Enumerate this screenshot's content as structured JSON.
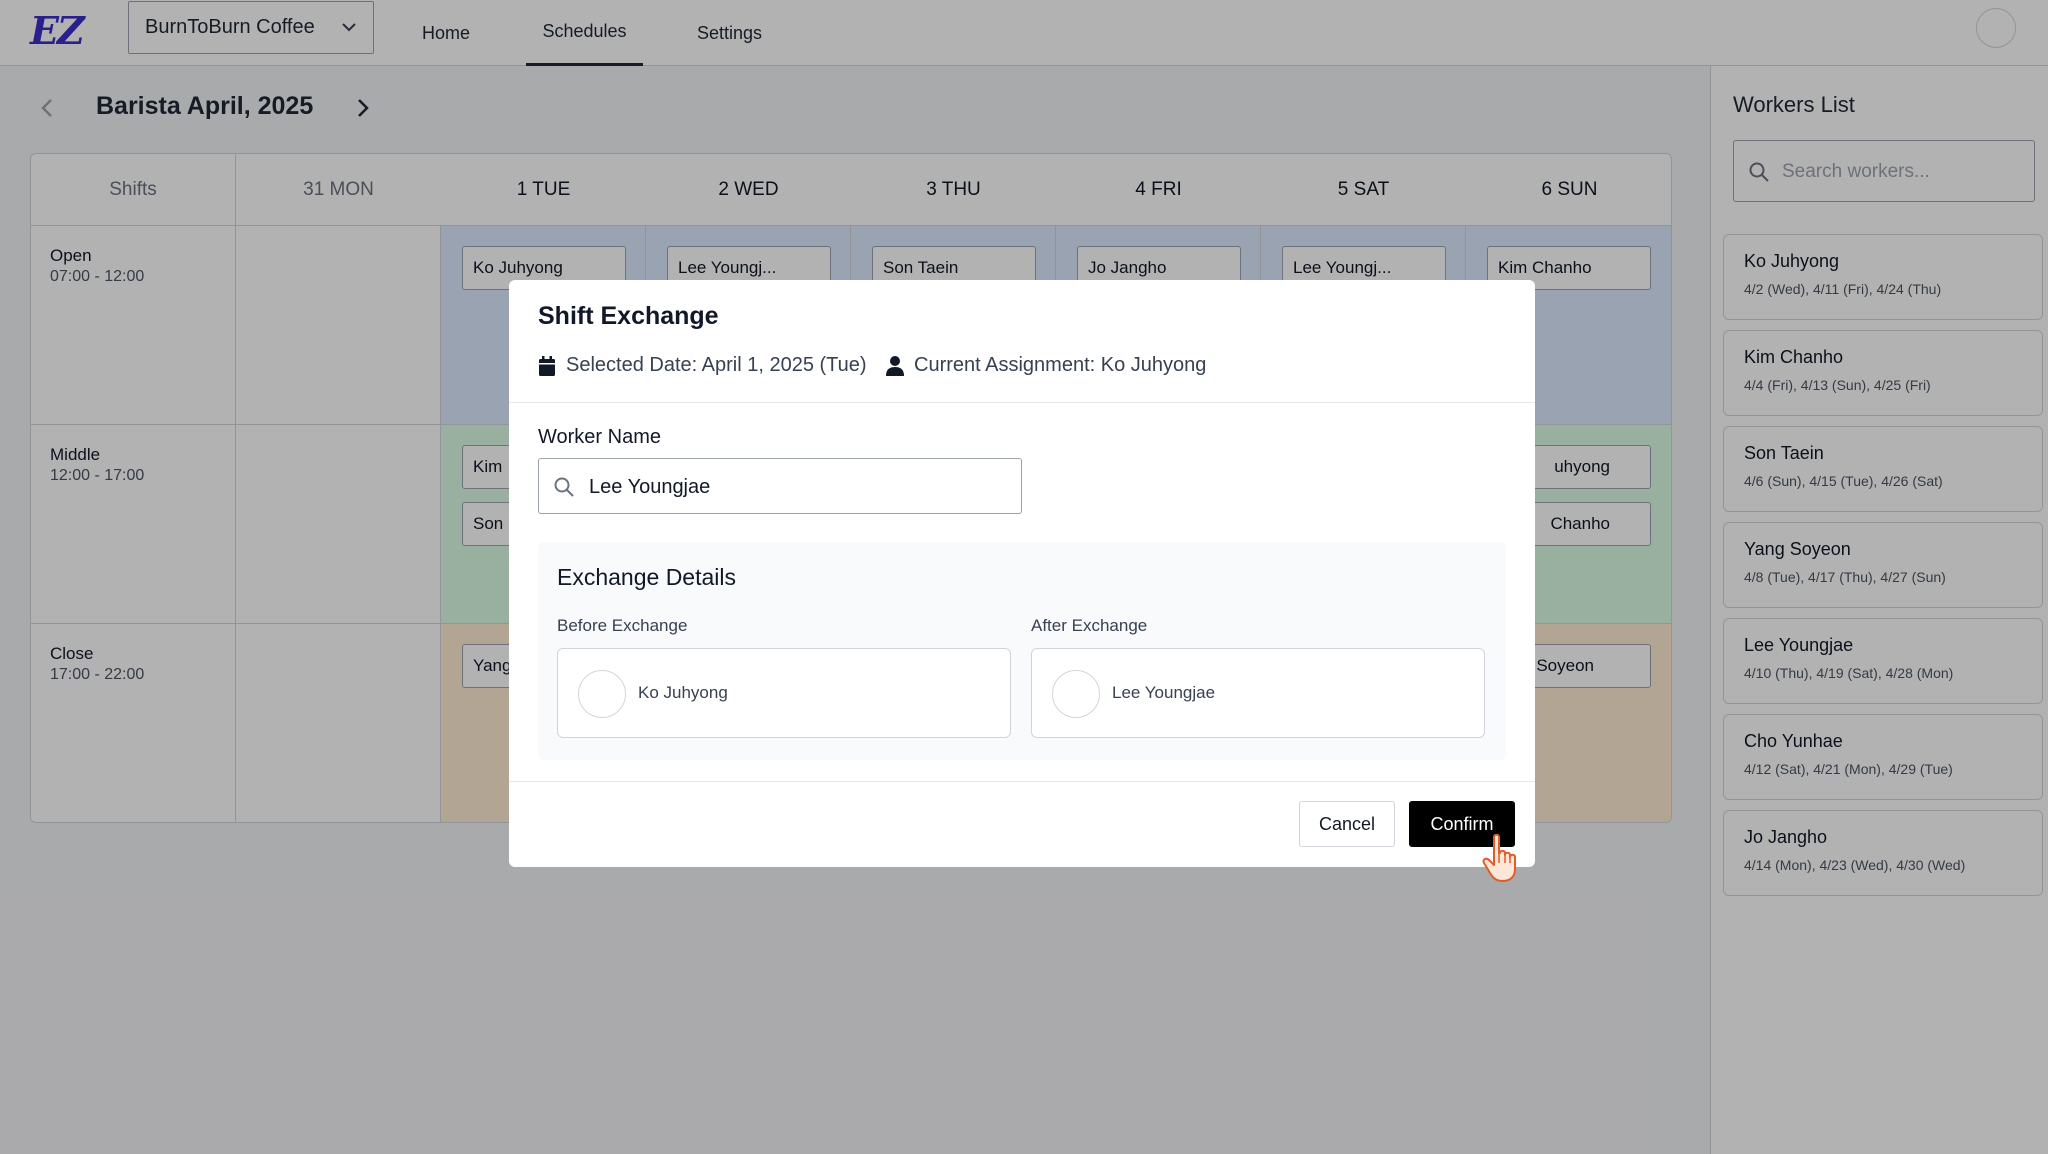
{
  "header": {
    "logo": "EZ",
    "store": "BurnToBurn Coffee",
    "nav": [
      {
        "label": "Home"
      },
      {
        "label": "Schedules",
        "active": true
      },
      {
        "label": "Settings"
      }
    ]
  },
  "schedule": {
    "title": "Barista April, 2025",
    "columns": [
      "Shifts",
      "31 MON",
      "1 TUE",
      "2 WED",
      "3 THU",
      "4 FRI",
      "5 SAT",
      "6 SUN"
    ],
    "rows": [
      {
        "name": "Open",
        "time": "07:00 - 12:00"
      },
      {
        "name": "Middle",
        "time": "12:00 - 17:00"
      },
      {
        "name": "Close",
        "time": "17:00 - 22:00"
      }
    ],
    "open_chips": [
      "Ko Juhyong",
      "Lee Youngj...",
      "Son Taein",
      "Jo Jangho",
      "Lee Youngj...",
      "Kim Chanho"
    ],
    "middle_chips": {
      "tue_1": "Kim",
      "tue_2": "Son",
      "sun_1": "uhyong",
      "sun_2": "Chanho"
    },
    "close_chips": {
      "tue_1": "Yang",
      "sun_1": "Soyeon"
    }
  },
  "workers_panel": {
    "title": "Workers List",
    "search_placeholder": "Search workers...",
    "workers": [
      {
        "name": "Ko Juhyong",
        "dates": "4/2 (Wed), 4/11 (Fri), 4/24 (Thu)"
      },
      {
        "name": "Kim Chanho",
        "dates": "4/4 (Fri), 4/13 (Sun), 4/25 (Fri)"
      },
      {
        "name": "Son Taein",
        "dates": "4/6 (Sun), 4/15 (Tue), 4/26 (Sat)"
      },
      {
        "name": "Yang Soyeon",
        "dates": "4/8 (Tue), 4/17 (Thu), 4/27 (Sun)"
      },
      {
        "name": "Lee Youngjae",
        "dates": "4/10 (Thu), 4/19 (Sat), 4/28 (Mon)"
      },
      {
        "name": "Cho Yunhae",
        "dates": "4/12 (Sat), 4/21 (Mon), 4/29 (Tue)"
      },
      {
        "name": "Jo Jangho",
        "dates": "4/14 (Mon), 4/23 (Wed), 4/30 (Wed)"
      }
    ]
  },
  "modal": {
    "title": "Shift Exchange",
    "selected_date": "Selected Date: April 1, 2025 (Tue)",
    "current_assignment": "Current Assignment: Ko Juhyong",
    "worker_name_label": "Worker Name",
    "worker_name_value": "Lee Youngjae",
    "details_title": "Exchange Details",
    "before_label": "Before Exchange",
    "before_name": "Ko Juhyong",
    "after_label": "After Exchange",
    "after_name": "Lee Youngjae",
    "cancel_label": "Cancel",
    "confirm_label": "Confirm"
  },
  "colors": {
    "brand": "#3b2fc9",
    "open_band": "#dbeafe",
    "middle_band": "#dcfce7",
    "close_band": "#ffedd5",
    "confirm_bg": "#000000"
  },
  "icons": [
    "chevron-down-icon",
    "chevron-left-icon",
    "chevron-right-icon",
    "search-icon",
    "calendar-icon",
    "user-icon",
    "hand-pointer-icon"
  ]
}
